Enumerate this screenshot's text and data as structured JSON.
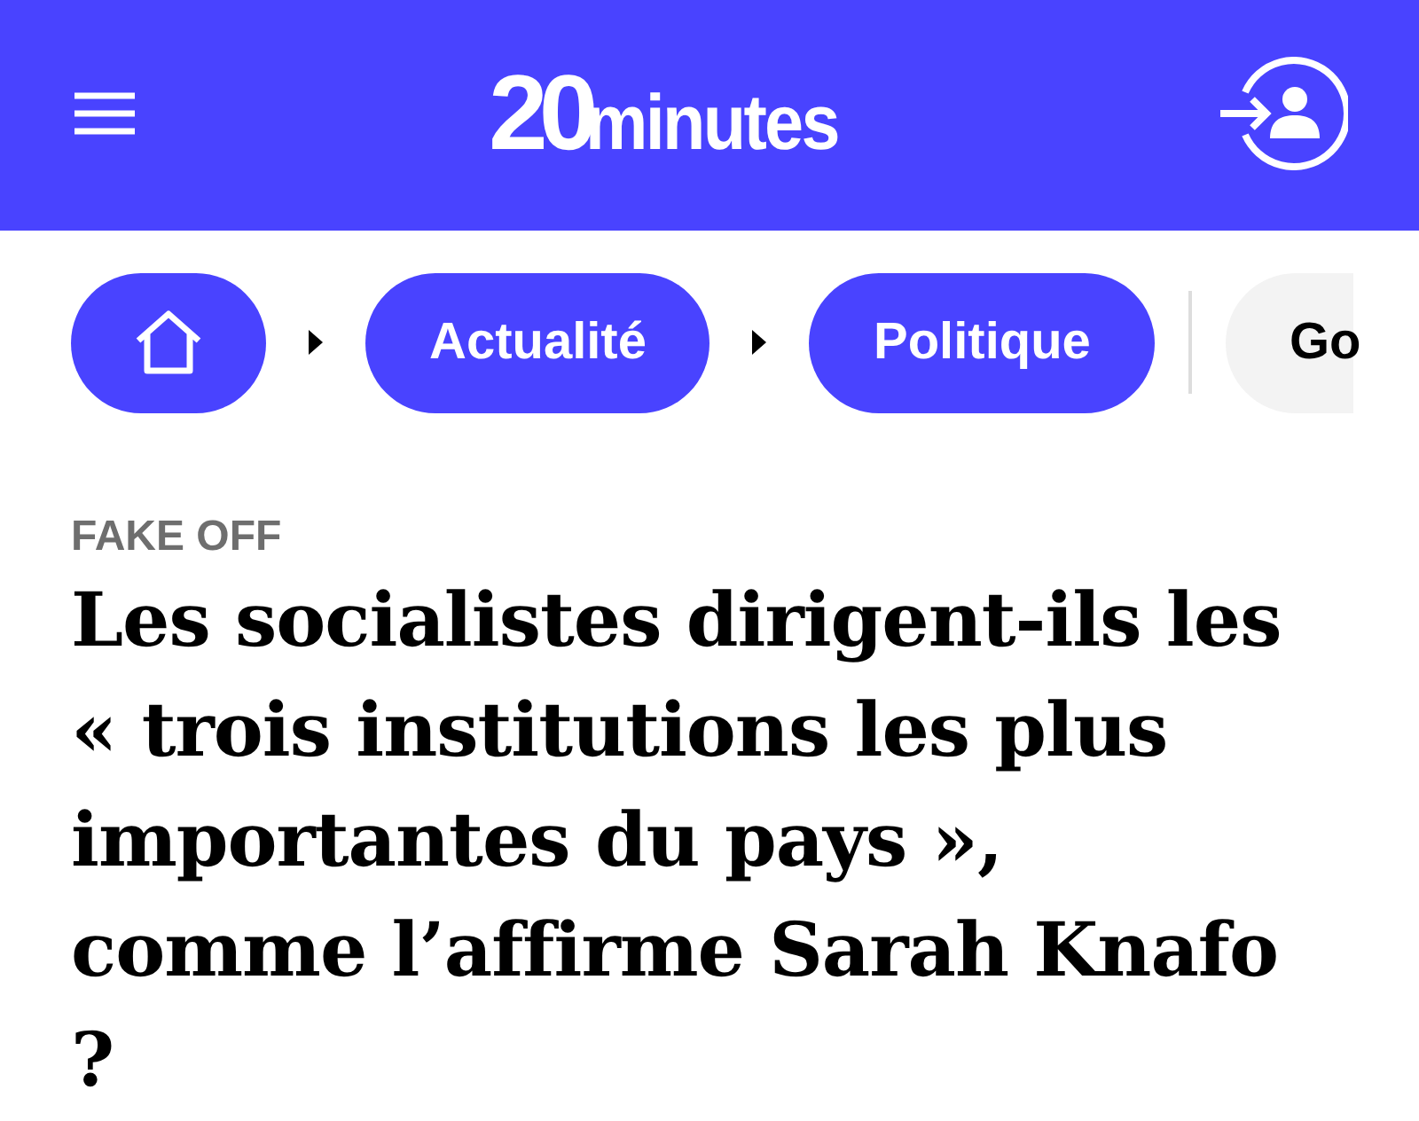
{
  "header": {
    "logo": {
      "number": "20",
      "word": "minutes"
    }
  },
  "breadcrumb": [
    {
      "kind": "home"
    },
    {
      "kind": "link",
      "label": "Actualité"
    },
    {
      "kind": "link",
      "label": "Politique"
    }
  ],
  "tags": [
    {
      "label": "Go"
    }
  ],
  "article": {
    "kicker": "FAKE OFF",
    "title": "Les socialistes dirigent-ils les « trois institutions les plus importantes du pays », comme l’affirme Sarah Knafo ?"
  }
}
